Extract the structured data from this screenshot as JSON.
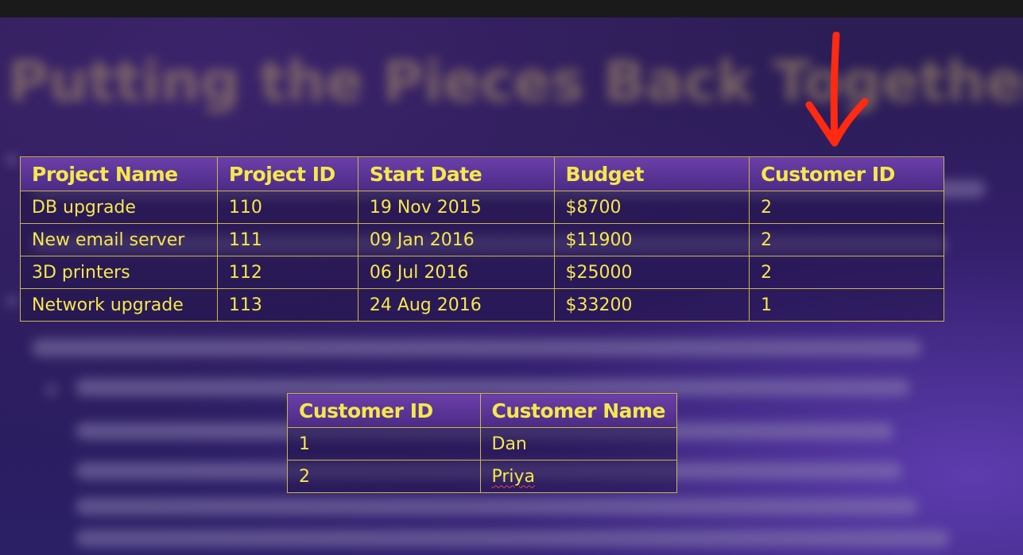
{
  "slide": {
    "title": "Putting the Pieces Back Together"
  },
  "projects_table": {
    "headers": [
      "Project Name",
      "Project ID",
      "Start Date",
      "Budget",
      "Customer ID"
    ],
    "rows": [
      [
        "DB upgrade",
        "110",
        "19 Nov 2015",
        "$8700",
        "2"
      ],
      [
        "New email server",
        "111",
        "09 Jan 2016",
        "$11900",
        "2"
      ],
      [
        "3D printers",
        "112",
        "06 Jul 2016",
        "$25000",
        "2"
      ],
      [
        "Network upgrade",
        "113",
        "24 Aug 2016",
        "$33200",
        "1"
      ]
    ]
  },
  "customers_table": {
    "headers": [
      "Customer ID",
      "Customer Name"
    ],
    "rows": [
      [
        "1",
        "Dan"
      ],
      [
        "2",
        "Priya"
      ]
    ]
  },
  "annotation": {
    "arrow_color": "#ff2a10",
    "icon": "down-arrow-icon"
  },
  "colors": {
    "text": "#f5e84a",
    "grid": "#c9b64a",
    "header_bg": "#5a339a",
    "slide_bg": "#2a1c5a"
  }
}
